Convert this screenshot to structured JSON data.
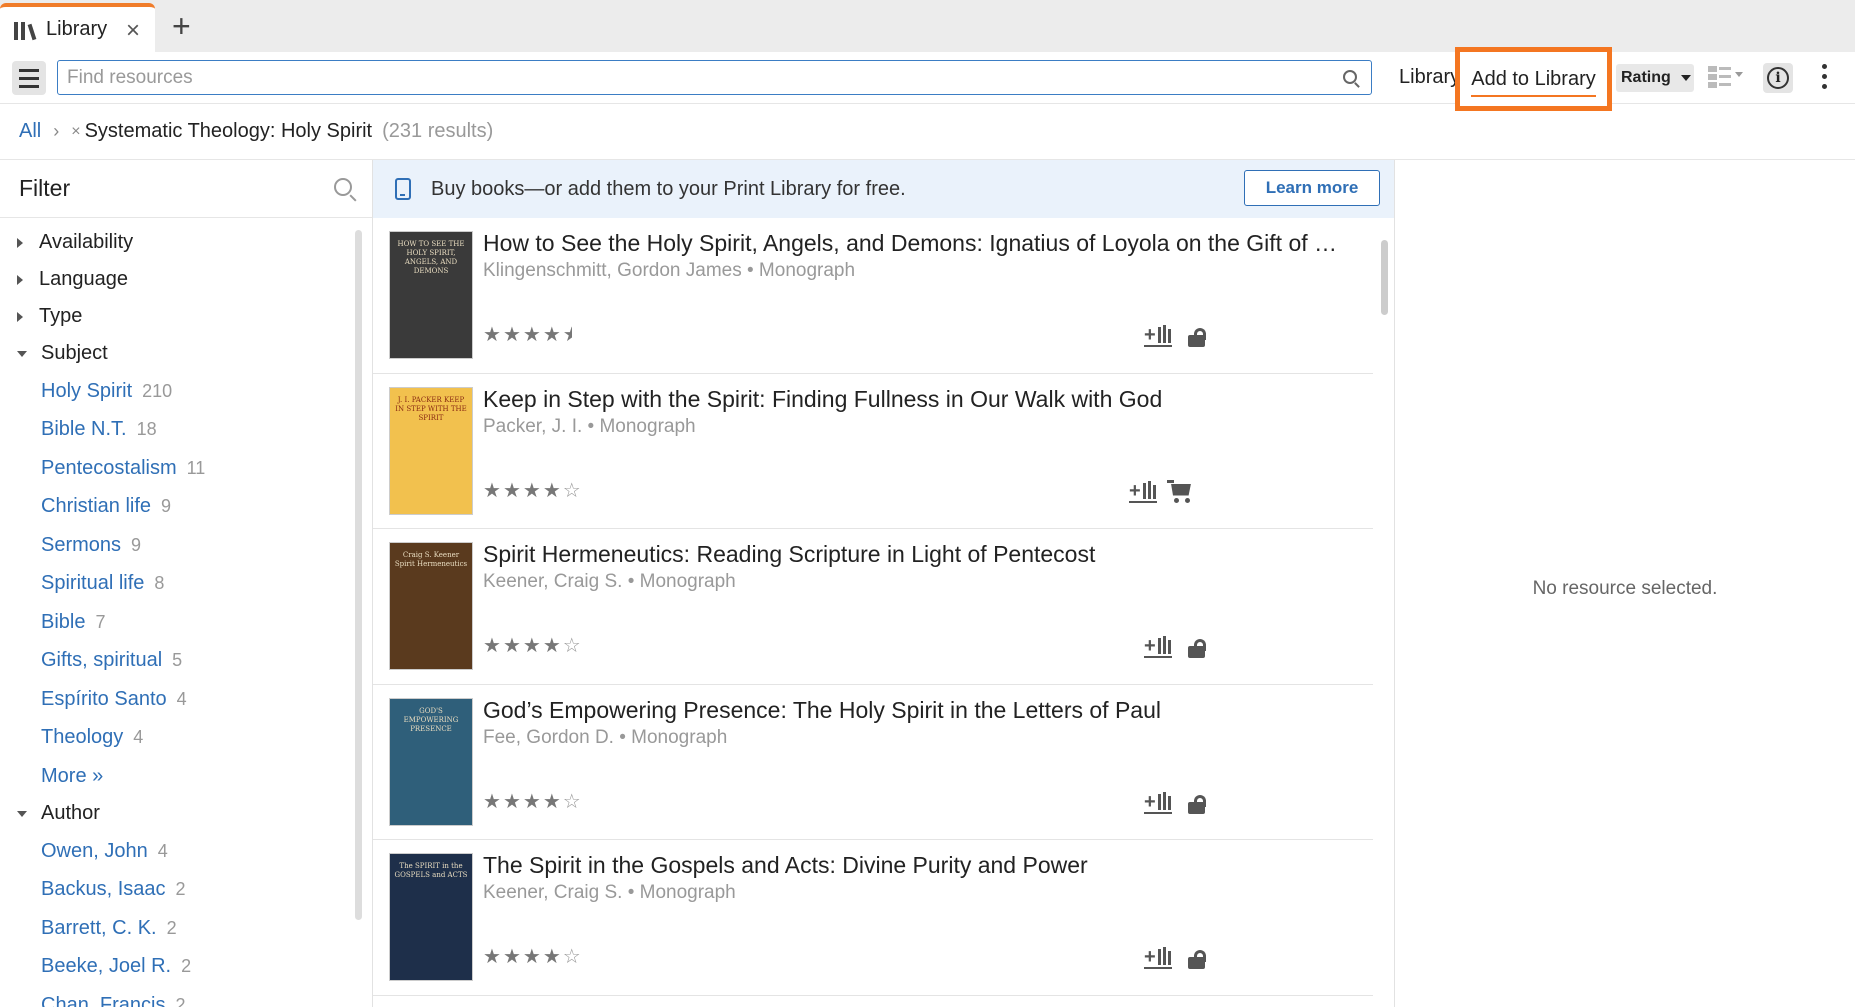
{
  "tab": {
    "title": "Library",
    "close": "×",
    "add": "+"
  },
  "toolbar": {
    "search_placeholder": "Find resources",
    "library_label": "Library",
    "add_to_library_label": "Add to Library",
    "rating_label": "Rating"
  },
  "breadcrumb": {
    "root": "All",
    "separator": "›",
    "remove": "×",
    "current": "Systematic Theology: Holy Spirit",
    "count": "(231 results)"
  },
  "filter": {
    "title": "Filter",
    "sections": [
      {
        "label": "Availability",
        "expanded": false
      },
      {
        "label": "Language",
        "expanded": false
      },
      {
        "label": "Type",
        "expanded": false
      },
      {
        "label": "Subject",
        "expanded": true
      },
      {
        "label": "Author",
        "expanded": true
      }
    ],
    "subject_items": [
      {
        "label": "Holy Spirit",
        "count": "210"
      },
      {
        "label": "Bible N.T.",
        "count": "18"
      },
      {
        "label": "Pentecostalism",
        "count": "11"
      },
      {
        "label": "Christian life",
        "count": "9"
      },
      {
        "label": "Sermons",
        "count": "9"
      },
      {
        "label": "Spiritual life",
        "count": "8"
      },
      {
        "label": "Bible",
        "count": "7"
      },
      {
        "label": "Gifts, spiritual",
        "count": "5"
      },
      {
        "label": "Espírito Santo",
        "count": "4"
      },
      {
        "label": "Theology",
        "count": "4"
      }
    ],
    "more_label": "More »",
    "author_items": [
      {
        "label": "Owen, John",
        "count": "4"
      },
      {
        "label": "Backus, Isaac",
        "count": "2"
      },
      {
        "label": "Barrett, C. K.",
        "count": "2"
      },
      {
        "label": "Beeke, Joel R.",
        "count": "2"
      },
      {
        "label": "Chan, Francis",
        "count": "2"
      }
    ]
  },
  "promo": {
    "text": "Buy books—or add them to your Print Library for free.",
    "button": "Learn more"
  },
  "results": [
    {
      "title": "How to See the Holy Spirit, Angels, and Demons: Ignatius of Loyola on the Gift of Discernment",
      "meta": "Klingenschmitt, Gordon James • Monograph",
      "rating": 4.5,
      "action": "lock",
      "cover_text": "HOW TO SEE THE HOLY SPIRIT, ANGELS, AND DEMONS",
      "cover_color": "#3a3a3a"
    },
    {
      "title": "Keep in Step with the Spirit: Finding Fullness in Our Walk with God",
      "meta": "Packer, J. I. • Monograph",
      "rating": 4,
      "action": "cart",
      "cover_text": "J. I. PACKER KEEP IN STEP WITH THE SPIRIT",
      "cover_color": "#f2c14e"
    },
    {
      "title": "Spirit Hermeneutics: Reading Scripture in Light of Pentecost",
      "meta": "Keener, Craig S. • Monograph",
      "rating": 4,
      "action": "lock",
      "cover_text": "Craig S. Keener Spirit Hermeneutics",
      "cover_color": "#5a3a1e"
    },
    {
      "title": "God’s Empowering Presence: The Holy Spirit in the Letters of Paul",
      "meta": "Fee, Gordon D. • Monograph",
      "rating": 4,
      "action": "lock",
      "cover_text": "GOD'S EMPOWERING PRESENCE",
      "cover_color": "#2f5f7a"
    },
    {
      "title": "The Spirit in the Gospels and Acts: Divine Purity and Power",
      "meta": "Keener, Craig S. • Monograph",
      "rating": 4,
      "action": "lock",
      "cover_text": "The SPIRIT in the GOSPELS and ACTS",
      "cover_color": "#1e2f4a"
    }
  ],
  "detail": {
    "empty_text": "No resource selected."
  }
}
